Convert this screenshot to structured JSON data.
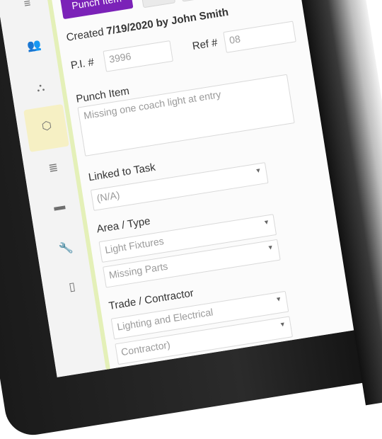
{
  "tabs": {
    "punch_item_label": "Punch Item"
  },
  "created": {
    "label": "Created",
    "value": "7/19/2020 by John Smith"
  },
  "ref": {
    "label": "Ref #",
    "value": "08"
  },
  "pi": {
    "label": "P.I. #",
    "value": "3996"
  },
  "punch_item": {
    "label": "Punch Item",
    "value": "Missing one coach light at entry"
  },
  "linked_task": {
    "label": "Linked to Task",
    "value": "(N/A)"
  },
  "area_type": {
    "label": "Area / Type",
    "area_value": "Light Fixtures",
    "type_value": "Missing Parts"
  },
  "trade": {
    "label": "Trade / Contractor",
    "trade_value": "Lighting and Electrical",
    "contractor_value": "Contractor)"
  },
  "icons": [
    "menu-icon",
    "people-icon",
    "sitemap-icon",
    "hexagon-icon",
    "database-icon",
    "truck-icon",
    "wrench-icon",
    "pdf-icon"
  ],
  "colors": {
    "accent": "#7b22b8",
    "save": "#3fae49",
    "active_bg": "#f6f0c4"
  }
}
